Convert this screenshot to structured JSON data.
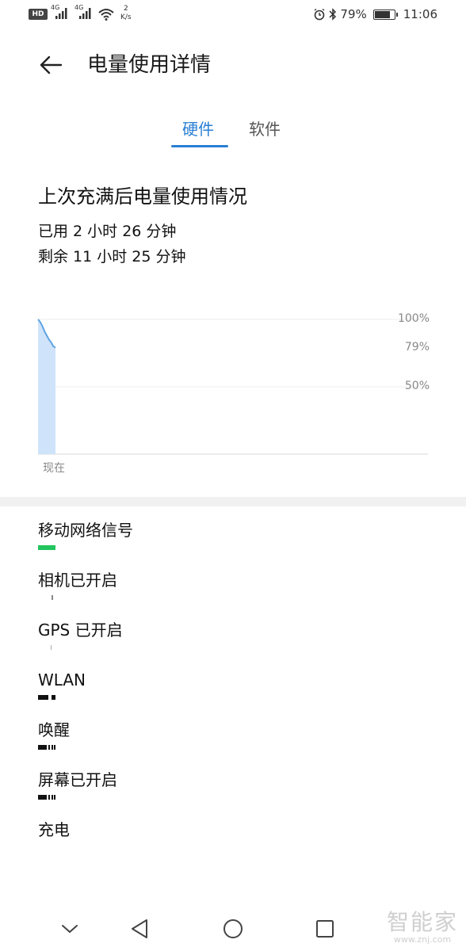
{
  "status_bar": {
    "hd": "HD",
    "sim1_label": "4G",
    "sim2_label": "4G",
    "speed_value": "2",
    "speed_unit": "K/s",
    "battery_percent": "79%",
    "battery_level": 0.79,
    "time": "11:06"
  },
  "header": {
    "title": "电量使用详情"
  },
  "tabs": [
    {
      "label": "硬件",
      "active": true
    },
    {
      "label": "软件",
      "active": false
    }
  ],
  "summary": {
    "title": "上次充满后电量使用情况",
    "used": "已用 2 小时 26 分钟",
    "remaining": "剩余 11 小时 25 分钟"
  },
  "chart_data": {
    "type": "area",
    "y_ticks": [
      "100%",
      "79%",
      "50%"
    ],
    "x_label": "现在",
    "ylim": [
      0,
      100
    ],
    "values": [
      100,
      98,
      95,
      91,
      88,
      85,
      83,
      80,
      79
    ],
    "current_percent": 79,
    "colors": {
      "line": "#5fa4e0",
      "fill": "#cfe3fb"
    }
  },
  "hardware": [
    {
      "label": "移动网络信号",
      "bar_color": "#22c55e"
    },
    {
      "label": "相机已开启"
    },
    {
      "label": "GPS 已开启"
    },
    {
      "label": "WLAN"
    },
    {
      "label": "唤醒"
    },
    {
      "label": "屏幕已开启"
    },
    {
      "label": "充电"
    }
  ],
  "watermark": {
    "text": "智能家",
    "url": "www.znj.com"
  },
  "colors": {
    "accent": "#2a7fd4"
  }
}
